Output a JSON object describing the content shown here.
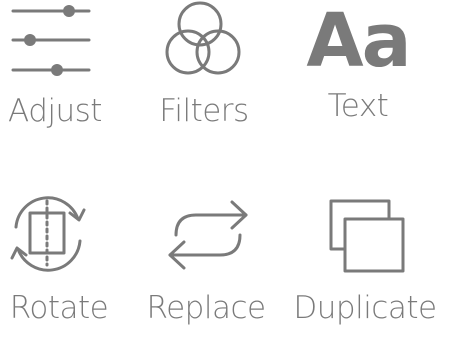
{
  "colors": {
    "icon": "#7a7a7a",
    "label": "#7a7a7a",
    "background": "#ffffff"
  },
  "tools": [
    {
      "id": "adjust",
      "label": "Adjust",
      "icon": "sliders-icon"
    },
    {
      "id": "filters",
      "label": "Filters",
      "icon": "overlapping-circles-icon"
    },
    {
      "id": "text",
      "label": "Text",
      "icon": "text-aa-icon",
      "glyph": "Aa"
    },
    {
      "id": "rotate",
      "label": "Rotate",
      "icon": "rotate-icon"
    },
    {
      "id": "replace",
      "label": "Replace",
      "icon": "swap-arrows-icon"
    },
    {
      "id": "duplicate",
      "label": "Duplicate",
      "icon": "duplicate-icon"
    }
  ]
}
